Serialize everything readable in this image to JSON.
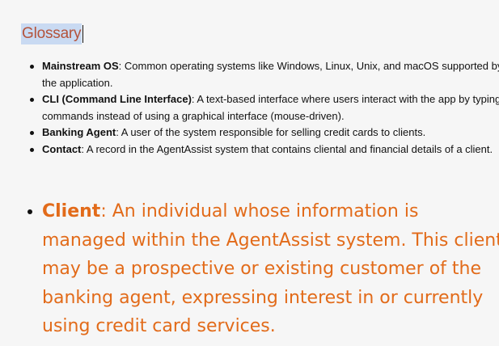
{
  "heading": "Glossary",
  "small_items": [
    {
      "term": "Mainstream OS",
      "definition": ": Common operating systems like Windows, Linux, Unix, and macOS supported by the application."
    },
    {
      "term": "CLI (Command Line Interface)",
      "definition": ": A text-based interface where users interact with the app by typing commands instead of using a graphical interface (mouse-driven)."
    },
    {
      "term": "Banking Agent",
      "definition": ": A user of the system responsible for selling credit cards to clients."
    },
    {
      "term": "Contact",
      "definition": ": A record in the AgentAssist system that contains cliental and financial details of a client."
    }
  ],
  "large_items": [
    {
      "term": "Client",
      "definition": ": An individual whose information is managed within the AgentAssist system. This client may be a prospective or existing customer of the banking agent, expressing interest in or currently using credit card services."
    }
  ],
  "colors": {
    "heading_text": "#b4533b",
    "heading_highlight": "#c9daf2",
    "large_text": "#e26b1a",
    "body_text": "#111111",
    "background": "#f6f6f6"
  }
}
